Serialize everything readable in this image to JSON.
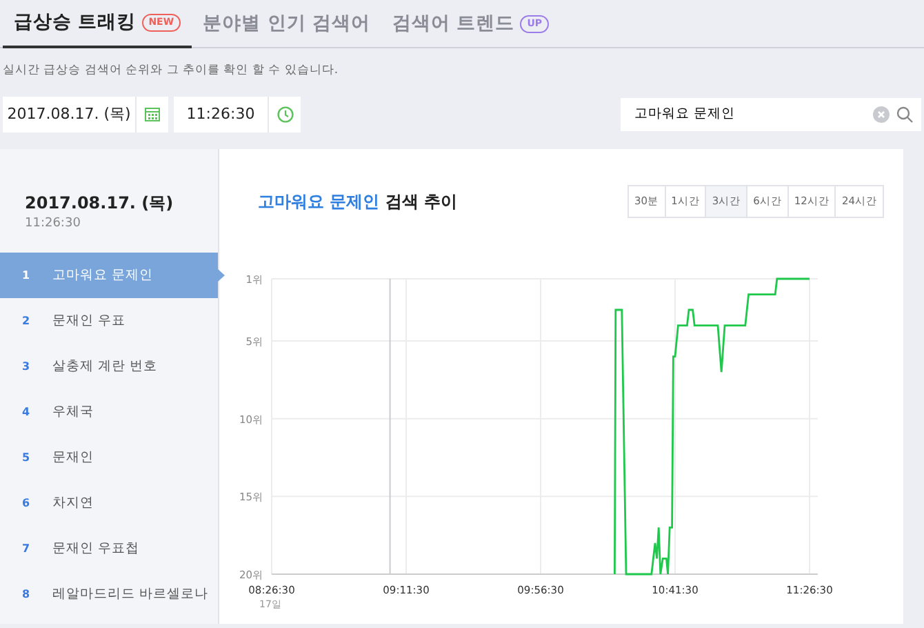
{
  "tabs": [
    {
      "label": "급상승 트래킹",
      "badge": "NEW",
      "color": "#f0605a",
      "selected": true
    },
    {
      "label": "분야별 인기 검색어",
      "selected": false
    },
    {
      "label": "검색어 트렌드",
      "badge": "UP",
      "color": "#9b7ce8",
      "selected": false
    }
  ],
  "description": "실시간 급상승 검색어 순위와 그 추이를 확인 할 수 있습니다.",
  "date_field": {
    "value": "2017.08.17. (목)"
  },
  "time_field": {
    "value": "11:26:30"
  },
  "search": {
    "value": "고마워요 문제인"
  },
  "sidebar": {
    "date": "2017.08.17. (목)",
    "time": "11:26:30",
    "items": [
      {
        "rank": "1",
        "label": "고마워요 문제인",
        "selected": true
      },
      {
        "rank": "2",
        "label": "문재인 우표",
        "selected": false
      },
      {
        "rank": "3",
        "label": "살충제 계란 번호",
        "selected": false
      },
      {
        "rank": "4",
        "label": "우체국",
        "selected": false
      },
      {
        "rank": "5",
        "label": "문재인",
        "selected": false
      },
      {
        "rank": "6",
        "label": "차지연",
        "selected": false
      },
      {
        "rank": "7",
        "label": "문재인 우표첩",
        "selected": false
      },
      {
        "rank": "8",
        "label": "레알마드리드 바르셀로나",
        "selected": false
      }
    ]
  },
  "trend": {
    "keyword": "고마워요 문제인",
    "title_suffix": "검색 추이",
    "ranges": [
      {
        "label": "30분",
        "selected": false
      },
      {
        "label": "1시간",
        "selected": false
      },
      {
        "label": "3시간",
        "selected": true
      },
      {
        "label": "6시간",
        "selected": false
      },
      {
        "label": "12시간",
        "selected": false
      },
      {
        "label": "24시간",
        "selected": false
      }
    ],
    "date_label": "17일",
    "chart_data": {
      "type": "line",
      "x": [
        37278,
        37296,
        37422,
        37506,
        38016,
        38088,
        38124,
        38160,
        38196,
        38244,
        38316,
        38346,
        38382,
        38430,
        38454,
        38490,
        38550,
        38730,
        38766,
        38844,
        38880,
        39348,
        39420,
        39486,
        39900,
        39966,
        40500,
        40536,
        41190
      ],
      "series": [
        {
          "color": "#1ec84a",
          "values": [
            20,
            3,
            3,
            20,
            20,
            18,
            19,
            17,
            20,
            19,
            19,
            20,
            17,
            17,
            6,
            6,
            4,
            4,
            3,
            3,
            4,
            4,
            7,
            4,
            4,
            2,
            2,
            1,
            1
          ]
        }
      ],
      "xlim": [
        30390,
        41190
      ],
      "ylim": [
        20,
        1
      ],
      "grid": true,
      "xticks": [
        {
          "value": 30390,
          "label": "08:26:30"
        },
        {
          "value": 33090,
          "label": "09:11:30"
        },
        {
          "value": 35790,
          "label": "09:56:30"
        },
        {
          "value": 38490,
          "label": "10:41:30"
        },
        {
          "value": 41190,
          "label": "11:26:30"
        }
      ],
      "yticks": [
        {
          "value": 1,
          "label": "1위"
        },
        {
          "value": 5,
          "label": "5위"
        },
        {
          "value": 10,
          "label": "10위"
        },
        {
          "value": 15,
          "label": "15위"
        },
        {
          "value": 20,
          "label": "20위"
        }
      ],
      "ref_lines": [
        {
          "axis": "x",
          "value": 32766
        }
      ]
    }
  }
}
